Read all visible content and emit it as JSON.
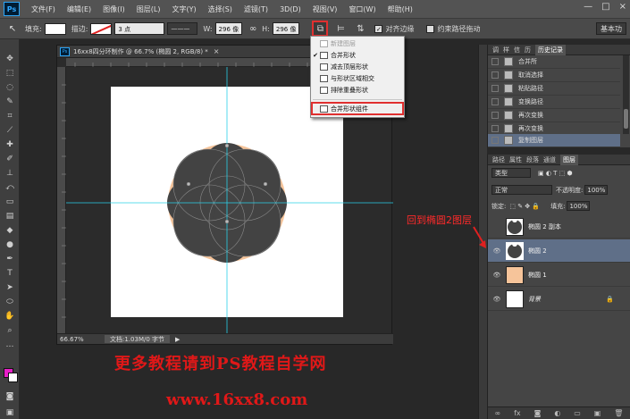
{
  "menubar": {
    "logo": "Ps",
    "items": [
      "文件(F)",
      "编辑(E)",
      "图像(I)",
      "图层(L)",
      "文字(Y)",
      "选择(S)",
      "滤镜(T)",
      "3D(D)",
      "视图(V)",
      "窗口(W)",
      "帮助(H)"
    ],
    "window_controls": [
      "—",
      "□",
      "×"
    ]
  },
  "optionsbar": {
    "fill_label": "填充:",
    "stroke_label": "描边:",
    "stroke_width": "3 点",
    "width_label": "W:",
    "width_value": "296 像",
    "height_label": "H:",
    "height_value": "296 像",
    "align_edges_label": "对齐边缘",
    "constrain_label": "约束路径拖动",
    "workspace": "基本功"
  },
  "document": {
    "title": "16xx8四分环制作 @ 66.7% (椭圆 2, RGB/8) *",
    "zoom": "66.67%",
    "info": "文档:1.03M/0 字节"
  },
  "dropdown": {
    "items": [
      {
        "label": "新建图层",
        "checked": false,
        "disabled": true
      },
      {
        "label": "合并形状",
        "checked": true,
        "disabled": false
      },
      {
        "label": "减去顶层形状",
        "checked": false,
        "disabled": false
      },
      {
        "label": "与形状区域相交",
        "checked": false,
        "disabled": false
      },
      {
        "label": "排除重叠形状",
        "checked": false,
        "disabled": false
      },
      {
        "label": "合并形状组件",
        "checked": false,
        "disabled": false
      }
    ]
  },
  "history": {
    "tabs": [
      "调",
      "样",
      "信",
      "历",
      "历史记录"
    ],
    "rows": [
      "合并所",
      "取消选择",
      "粘贴路径",
      "变换路径",
      "再次变换",
      "再次变换",
      "复制图层"
    ],
    "selected_index": 6
  },
  "layers": {
    "tabs": [
      "路径",
      "属性",
      "段落",
      "通道",
      "图层"
    ],
    "filter": "类型",
    "blend_mode": "正常",
    "opacity_label": "不透明度:",
    "opacity_value": "100%",
    "lock_label": "锁定:",
    "fill_label": "填充:",
    "fill_value": "100%",
    "rows": [
      {
        "name": "椭圆 2 副本",
        "visible": false,
        "thumb": "dark",
        "selected": false
      },
      {
        "name": "椭圆 2",
        "visible": true,
        "thumb": "dark",
        "selected": true
      },
      {
        "name": "椭圆 1",
        "visible": true,
        "thumb": "peach",
        "selected": false
      },
      {
        "name": "背景",
        "visible": true,
        "thumb": "white",
        "selected": false
      }
    ],
    "footer_icons": [
      "link-icon",
      "fx-icon",
      "mask-icon",
      "adjustment-icon",
      "folder-icon",
      "new-layer-icon",
      "trash-icon"
    ]
  },
  "annotation": {
    "text": "回到椭圆2图层"
  },
  "watermark": {
    "line1": "更多教程请到PS教程自学网",
    "line2": "www.16xx8.com"
  },
  "colors": {
    "foreground": "#e81ec8",
    "background": "#ffffff",
    "shape_dark": "#424242",
    "shape_peach": "#f6c49a",
    "guide": "#2ad0e8",
    "annotation_red": "#e03030"
  }
}
